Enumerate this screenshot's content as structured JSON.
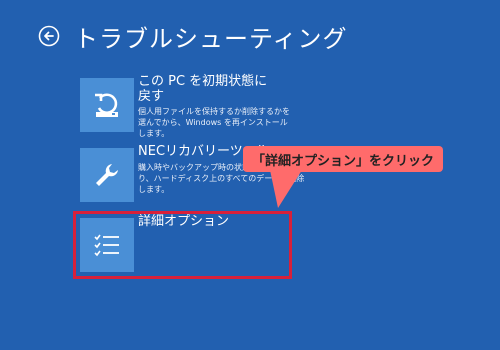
{
  "header": {
    "title": "トラブルシューティング",
    "back_icon": "back-arrow-icon"
  },
  "options": [
    {
      "title_line1": "この PC を初期状態に",
      "title_line2": "戻す",
      "desc_line1": "個人用ファイルを保持するか削除するかを",
      "desc_line2": "選んでから、Windows を再インストール",
      "desc_line3": "します。",
      "icon": "reset-pc-icon"
    },
    {
      "title_line1": "NECリカバリーツール",
      "desc_line1": "購入時やバックアップ時の状態",
      "desc_line2": "り、ハードディスク上のすべてのデータを削除",
      "desc_line3": "します。",
      "icon": "wrench-icon"
    },
    {
      "title_line1": "詳細オプション",
      "icon": "checklist-icon"
    }
  ],
  "callout": {
    "text": "「詳細オプション」をクリック",
    "color": "#ff6b6b"
  },
  "colors": {
    "background": "#2260b0",
    "tile": "#4a8fd6",
    "highlight": "#d8203a"
  }
}
